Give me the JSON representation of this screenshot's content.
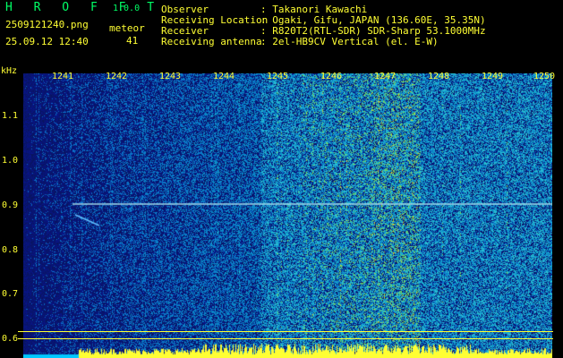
{
  "app": {
    "name": "H R O F F T",
    "version": "1.0.0"
  },
  "file": {
    "name": "2509121240.png",
    "date": "25.09.12 12:40"
  },
  "meteor": {
    "label": "meteor",
    "count": "41"
  },
  "info": [
    {
      "label": "Observer",
      "value": ": Takanori Kawachi"
    },
    {
      "label": "Receiving Location",
      "value": ": Ogaki, Gifu, JAPAN (136.60E, 35.35N)"
    },
    {
      "label": "Receiver",
      "value": ": R820T2(RTL-SDR) SDR-Sharp 53.1000MHz"
    },
    {
      "label": "Receiving antenna",
      "value": ": 2el-HB9CV Vertical (el. E-W)"
    }
  ],
  "axis": {
    "unit": "kHz",
    "y_ticks": [
      "1.1",
      "1.0",
      "0.9",
      "0.8",
      "0.7",
      "0.6"
    ],
    "x_ticks": [
      "1241",
      "1242",
      "1243",
      "1244",
      "1245",
      "1246",
      "1247",
      "1248",
      "1249",
      "1250"
    ]
  },
  "colors": {
    "green": "#00ff66",
    "yellow": "#ffff33",
    "noise": "#1530a0",
    "carrier": "#a0d8e8"
  }
}
